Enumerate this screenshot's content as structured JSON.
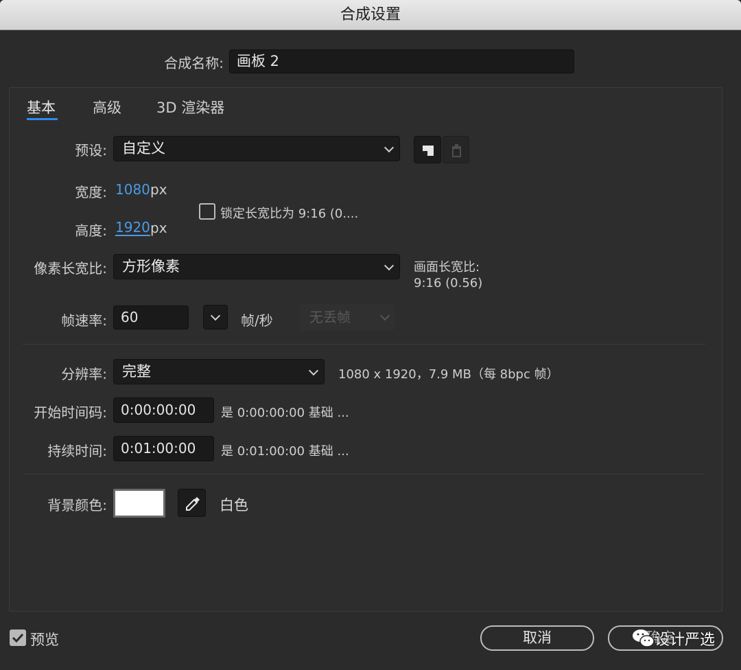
{
  "window": {
    "title": "合成设置"
  },
  "comp_name": {
    "label": "合成名称:",
    "value": "画板 2"
  },
  "tabs": [
    {
      "label": "基本",
      "active": true
    },
    {
      "label": "高级",
      "active": false
    },
    {
      "label": "3D 渲染器",
      "active": false
    }
  ],
  "preset": {
    "label": "预设:",
    "value": "自定义"
  },
  "width": {
    "label": "宽度:",
    "value": "1080",
    "unit": "px"
  },
  "height": {
    "label": "高度:",
    "value": "1920",
    "unit": "px"
  },
  "lock_aspect": {
    "label": "锁定长宽比为 9:16 (0....",
    "checked": false
  },
  "pixel_aspect": {
    "label": "像素长宽比:",
    "value": "方形像素",
    "frame_aspect_label": "画面长宽比:",
    "frame_aspect_value": "9:16 (0.56)"
  },
  "frame_rate": {
    "label": "帧速率:",
    "value": "60",
    "unit": "帧/秒",
    "drop_frame": "无丢帧"
  },
  "resolution": {
    "label": "分辨率:",
    "value": "完整",
    "info": "1080 x 1920，7.9 MB（每 8bpc 帧）"
  },
  "start_timecode": {
    "label": "开始时间码:",
    "value": "0:00:00:00",
    "info": "是 0:00:00:00  基础 ..."
  },
  "duration": {
    "label": "持续时间:",
    "value": "0:01:00:00",
    "info": "是 0:01:00:00  基础 ..."
  },
  "background": {
    "label": "背景颜色:",
    "color": "#ffffff",
    "name": "白色"
  },
  "footer": {
    "preview_label": "预览",
    "preview_checked": true,
    "cancel_label": "取消",
    "ok_label": "确定",
    "watermark": "设计严选"
  },
  "colors": {
    "accent": "#2d8ceb",
    "link": "#4a9be8"
  }
}
